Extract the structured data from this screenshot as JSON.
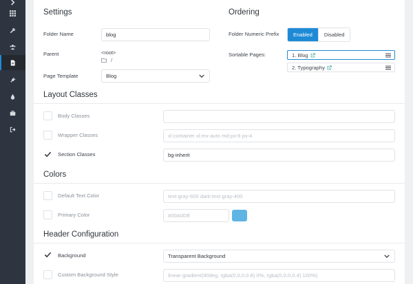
{
  "sidebar": {
    "items": [
      {
        "icon": "chevron-right-icon",
        "active": false
      },
      {
        "icon": "grid-icon",
        "active": false
      },
      {
        "icon": "wrench-icon",
        "active": false
      },
      {
        "icon": "users-icon",
        "active": false
      },
      {
        "icon": "file-icon",
        "active": true
      },
      {
        "icon": "plug-icon",
        "active": false
      },
      {
        "icon": "drop-icon",
        "active": false
      },
      {
        "icon": "briefcase-icon",
        "active": false
      },
      {
        "icon": "sign-out-icon",
        "active": false
      }
    ]
  },
  "settings": {
    "title": "Settings",
    "folder_name_label": "Folder Name",
    "folder_name_value": "blog",
    "parent_label": "Parent",
    "parent_value": "<root>",
    "parent_path": "/",
    "page_template_label": "Page Template",
    "page_template_value": "Blog"
  },
  "ordering": {
    "title": "Ordering",
    "numeric_prefix_label": "Folder Numeric Prefix",
    "enabled_label": "Enabled",
    "disabled_label": "Disabled",
    "sortable_label": "Sortable Pages:",
    "pages": [
      "1. Blog",
      "2. Typography"
    ]
  },
  "layout_classes": {
    "title": "Layout Classes",
    "body_label": "Body Classes",
    "body_value": "",
    "wrapper_label": "Wrapper Classes",
    "wrapper_placeholder": "xl:container xl:mx-auto md:px-6 px-4",
    "section_label": "Section Classes",
    "section_value": "bg-inherit"
  },
  "colors": {
    "title": "Colors",
    "default_text_label": "Default Text Color",
    "default_text_placeholder": "text-gray-600 dark:text-gray-400",
    "primary_label": "Primary Color",
    "primary_placeholder": "#00A0DE",
    "primary_swatch": "#5fb4e4"
  },
  "header_config": {
    "title": "Header Configuration",
    "background_label": "Background",
    "background_value": "Transparent Background",
    "custom_bg_label": "Custom Background Style",
    "custom_bg_placeholder": "linear-gradient(90deg, rgba(0,0,0,0.8) 0%, rgba(0,0,0,0.4) 100%)"
  },
  "theme": {
    "accent": "#1e8ad6",
    "sidebar_bg": "#2f3540"
  }
}
